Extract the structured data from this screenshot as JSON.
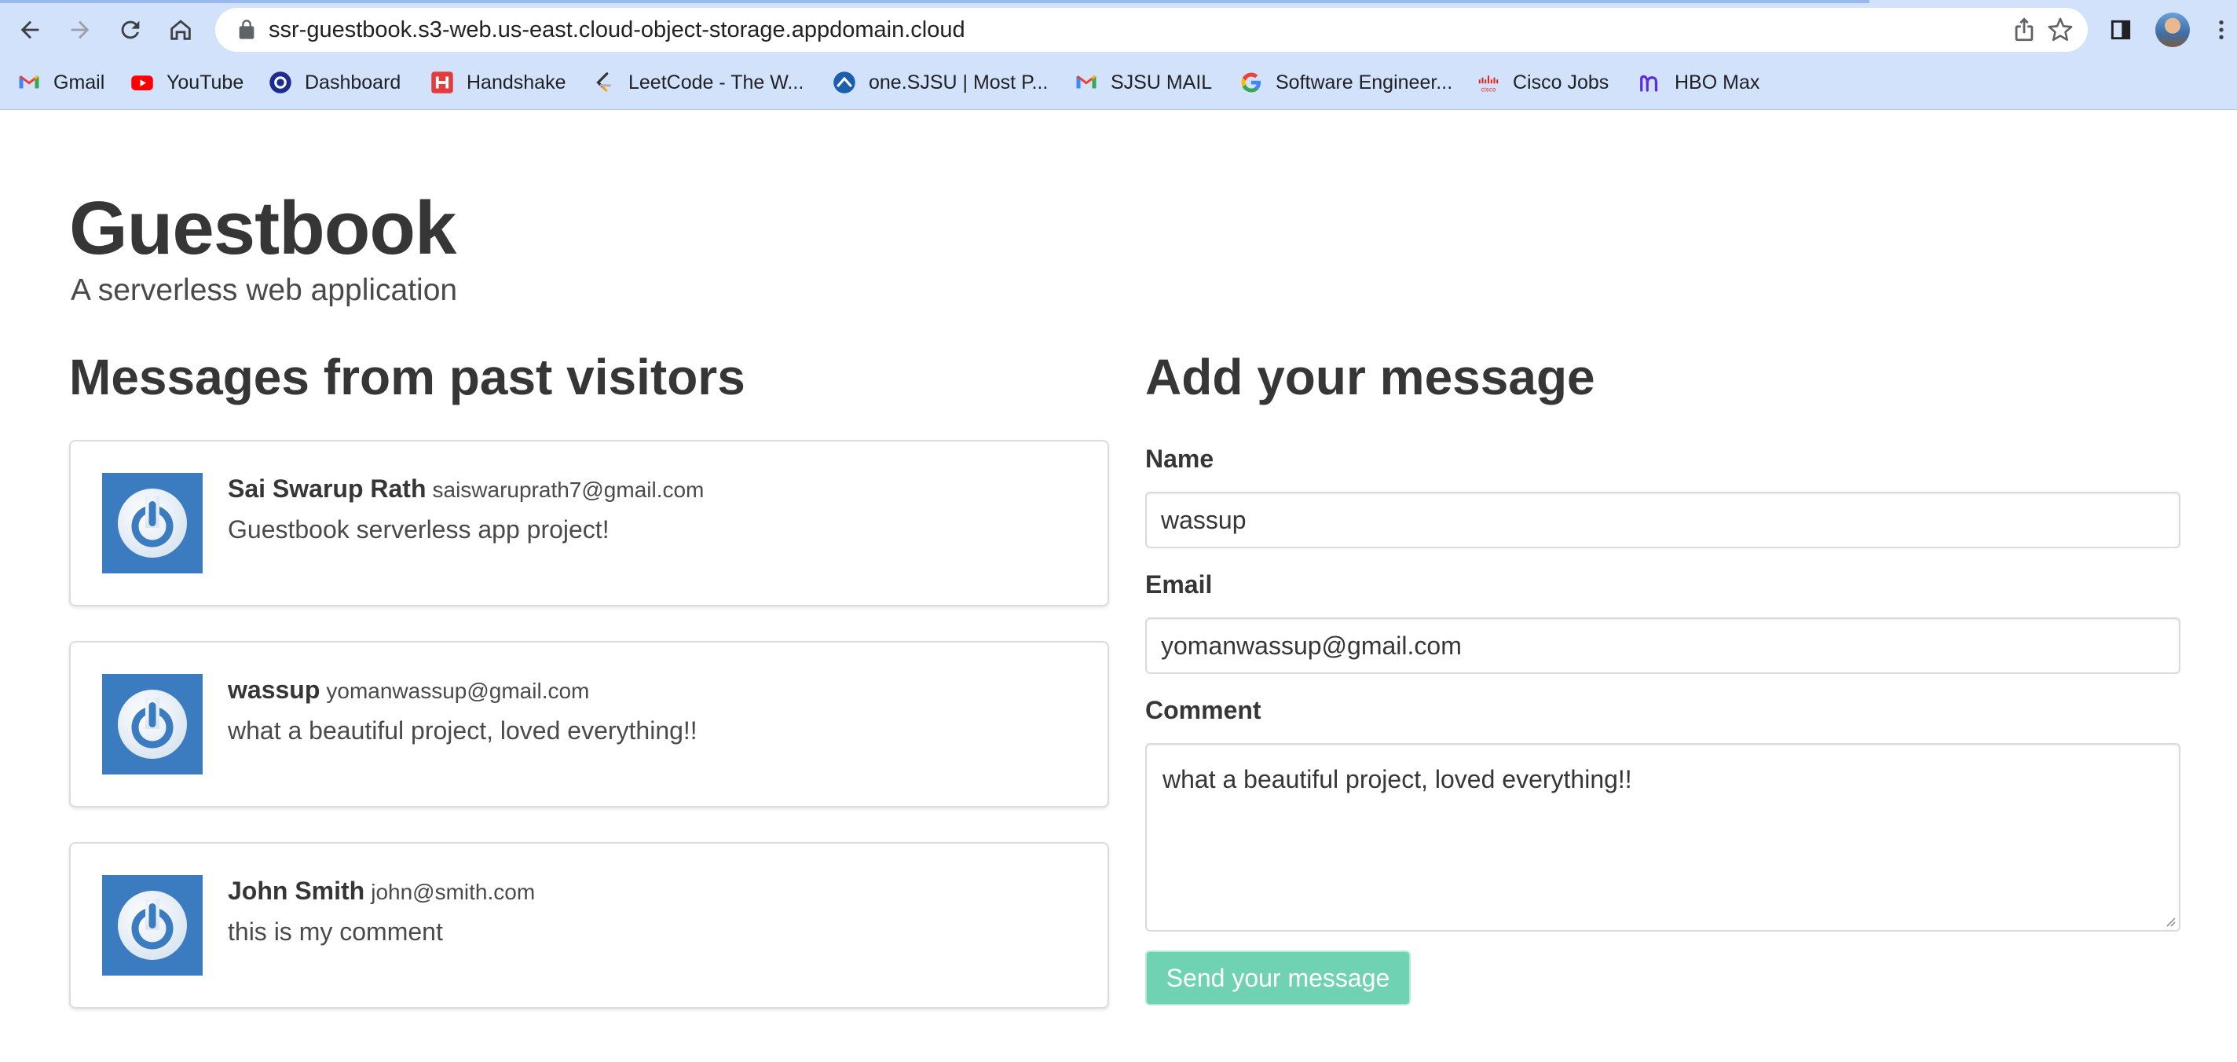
{
  "browser": {
    "url": "ssr-guestbook.s3-web.us-east.cloud-object-storage.appdomain.cloud",
    "bookmarks": [
      {
        "label": "Gmail",
        "icon": "gmail-icon"
      },
      {
        "label": "YouTube",
        "icon": "youtube-icon"
      },
      {
        "label": "Dashboard",
        "icon": "dashboard-icon"
      },
      {
        "label": "Handshake",
        "icon": "handshake-icon"
      },
      {
        "label": "LeetCode - The W...",
        "icon": "leetcode-icon"
      },
      {
        "label": "one.SJSU | Most P...",
        "icon": "sjsu-icon"
      },
      {
        "label": "SJSU MAIL",
        "icon": "gmail-icon"
      },
      {
        "label": "Software Engineer...",
        "icon": "google-icon"
      },
      {
        "label": "Cisco Jobs",
        "icon": "cisco-icon"
      },
      {
        "label": "HBO Max",
        "icon": "hbomax-icon"
      }
    ]
  },
  "page": {
    "title": "Guestbook",
    "subtitle": "A serverless web application"
  },
  "messages": {
    "heading": "Messages from past visitors",
    "items": [
      {
        "name": "Sai Swarup Rath",
        "email": "saiswaruprath7@gmail.com",
        "comment": "Guestbook serverless app project!"
      },
      {
        "name": "wassup",
        "email": "yomanwassup@gmail.com",
        "comment": "what a beautiful project, loved everything!!"
      },
      {
        "name": "John Smith",
        "email": "john@smith.com",
        "comment": "this is my comment"
      }
    ]
  },
  "form": {
    "heading": "Add your message",
    "name_label": "Name",
    "name_value": "wassup",
    "email_label": "Email",
    "email_value": "yomanwassup@gmail.com",
    "comment_label": "Comment",
    "comment_value": "what a beautiful project, loved everything!!",
    "submit_label": "Send your message"
  },
  "colors": {
    "chrome_bg": "#d3e2fb",
    "avatar_bg": "#3b7cc1",
    "button_bg": "#6fd3b3"
  }
}
